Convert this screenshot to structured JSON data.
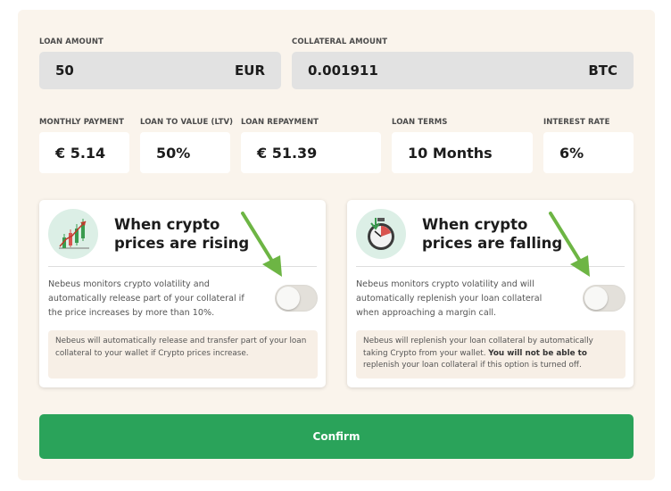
{
  "loan": {
    "label": "LOAN AMOUNT",
    "value": "50",
    "unit": "EUR"
  },
  "collateral": {
    "label": "COLLATERAL AMOUNT",
    "value": "0.001911",
    "unit": "BTC"
  },
  "stats": {
    "monthly_payment": {
      "label": "MONTHLY PAYMENT",
      "value": "€ 5.14"
    },
    "ltv": {
      "label": "LOAN TO VALUE (LTV)",
      "value": "50%"
    },
    "repayment": {
      "label": "LOAN REPAYMENT",
      "value": "€ 51.39"
    },
    "terms": {
      "label": "LOAN TERMS",
      "value": "10 Months"
    },
    "interest": {
      "label": "INTEREST RATE",
      "value": "6%"
    }
  },
  "rising": {
    "title": "When crypto prices are rising",
    "description": "Nebeus monitors crypto volatility and automatically release part of your collateral if the price increases by more than 10%.",
    "note": "Nebeus will automatically release and transfer part of your loan collateral to your wallet if Crypto prices increase.",
    "toggle_on": false,
    "icon": "rising-chart-icon"
  },
  "falling": {
    "title": "When crypto prices are falling",
    "description": "Nebeus monitors crypto volatility and will automatically replenish your loan collateral when approaching a margin call.",
    "note_start": "Nebeus will replenish your loan collateral by automatically taking Crypto from your wallet. ",
    "note_bold": "You will not be able to",
    "note_end": " replenish your loan collateral if this option is turned off.",
    "toggle_on": false,
    "icon": "stopwatch-icon"
  },
  "confirm_label": "Confirm",
  "colors": {
    "accent": "#2aa35a",
    "arrow": "#6db544",
    "panel": "#faf4ec"
  }
}
